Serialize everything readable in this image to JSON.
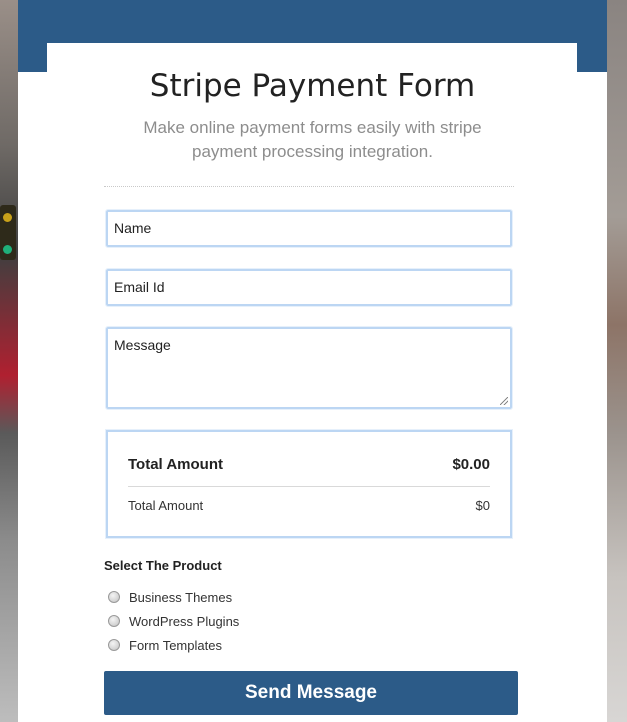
{
  "form": {
    "title": "Stripe Payment Form",
    "subtitle": "Make online payment forms easily with stripe payment processing integration.",
    "fields": {
      "name_placeholder": "Name",
      "email_placeholder": "Email Id",
      "message_placeholder": "Message"
    },
    "totals": {
      "primary_label": "Total Amount",
      "primary_value": "$0.00",
      "secondary_label": "Total Amount",
      "secondary_value": "$0"
    },
    "product_section": {
      "label": "Select The Product",
      "options": [
        "Business Themes",
        "WordPress Plugins",
        "Form Templates"
      ]
    },
    "submit_label": "Send Message"
  },
  "colors": {
    "brand_blue": "#2c5b88",
    "field_border": "#bcd6f3"
  }
}
